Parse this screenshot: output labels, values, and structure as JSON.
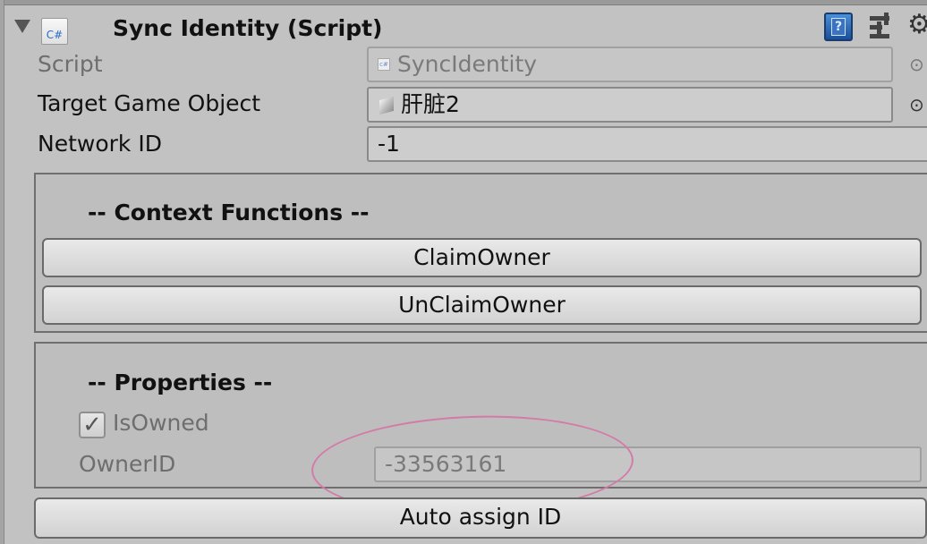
{
  "component": {
    "title": "Sync Identity (Script)",
    "icon_label": "C#"
  },
  "properties": {
    "script_label": "Script",
    "script_value": "SyncIdentity",
    "target_label": "Target Game Object",
    "target_value": "肝脏2",
    "network_id_label": "Network ID",
    "network_id_value": "-1"
  },
  "context_functions": {
    "heading": "-- Context Functions --",
    "buttons": [
      "ClaimOwner",
      "UnClaimOwner"
    ]
  },
  "properties_section": {
    "heading": "-- Properties --",
    "is_owned_label": "IsOwned",
    "is_owned_checked": true,
    "owner_id_label": "OwnerID",
    "owner_id_value": "-33563161"
  },
  "auto_assign_label": "Auto assign ID",
  "icons": {
    "help": "help-icon",
    "presets": "presets-icon",
    "settings": "gear-icon",
    "object_picker": "object-picker-icon",
    "script_file": "cs-script-icon",
    "game_object": "cube-icon",
    "foldout": "foldout-triangle-icon",
    "checkmark": "checkmark-icon"
  },
  "colors": {
    "annotation_ellipse": "#d47aa7",
    "help_icon": "#2f6ab8"
  }
}
